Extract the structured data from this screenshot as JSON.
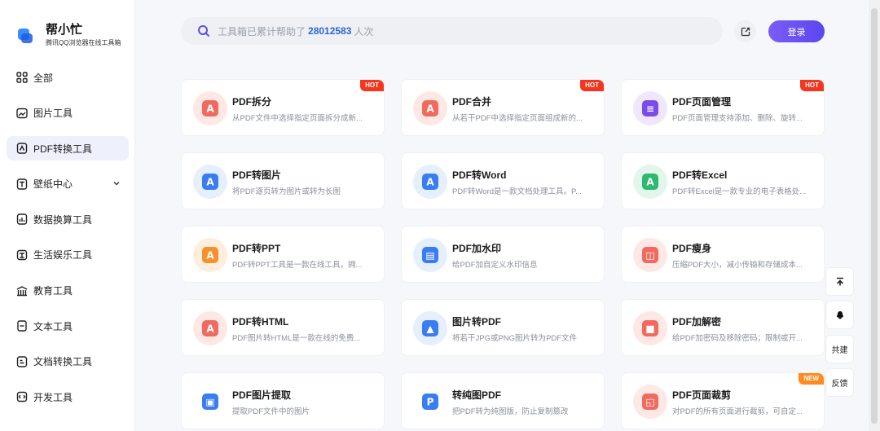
{
  "brand": {
    "name": "帮小忙",
    "tagline": "腾讯QQ浏览器在线工具箱"
  },
  "sidebar": {
    "items": [
      {
        "label": "全部",
        "icon": "grid-icon"
      },
      {
        "label": "图片工具",
        "icon": "image-icon"
      },
      {
        "label": "PDF转换工具",
        "icon": "pdf-icon",
        "active": true
      },
      {
        "label": "壁纸中心",
        "icon": "wallpaper-icon",
        "has_chevron": true
      },
      {
        "label": "数据换算工具",
        "icon": "data-icon"
      },
      {
        "label": "生活娱乐工具",
        "icon": "entertainment-icon"
      },
      {
        "label": "教育工具",
        "icon": "education-icon"
      },
      {
        "label": "文本工具",
        "icon": "text-icon"
      },
      {
        "label": "文档转换工具",
        "icon": "doc-convert-icon"
      },
      {
        "label": "开发工具",
        "icon": "dev-icon"
      }
    ]
  },
  "header": {
    "search_prefix": "工具箱已累计帮助了",
    "search_count": "28012583",
    "search_suffix": "人次",
    "login_label": "登录"
  },
  "tools": [
    {
      "title": "PDF拆分",
      "desc": "从PDF文件中选择指定页面拆分成新...",
      "badge": "HOT",
      "icon": "pdf-split-icon",
      "color": "#f06a5f",
      "bg": "#fde8e6"
    },
    {
      "title": "PDF合并",
      "desc": "从若干PDF中选择指定页面组成新的...",
      "badge": "HOT",
      "icon": "pdf-merge-icon",
      "color": "#f06a5f",
      "bg": "#fde8e6"
    },
    {
      "title": "PDF页面管理",
      "desc": "PDF页面管理支持添加、删除、旋转...",
      "badge": "HOT",
      "icon": "pdf-page-manage-icon",
      "color": "#7b4de8",
      "bg": "#efe8fc"
    },
    {
      "title": "PDF转图片",
      "desc": "将PDF逐页转为图片或转为长图",
      "badge": "",
      "icon": "pdf-to-image-icon",
      "color": "#3a7cf2",
      "bg": "#e6effd"
    },
    {
      "title": "PDF转Word",
      "desc": "PDF转Word是一款文档处理工具。P...",
      "badge": "",
      "icon": "pdf-to-word-icon",
      "color": "#3a7cf2",
      "bg": "#e6effd"
    },
    {
      "title": "PDF转Excel",
      "desc": "PDF转Excel是一款专业的电子表格处...",
      "badge": "",
      "icon": "pdf-to-excel-icon",
      "color": "#2eb872",
      "bg": "#e3f6ec"
    },
    {
      "title": "PDF转PPT",
      "desc": "PDF转PPT工具是一款在线工具，拥...",
      "badge": "",
      "icon": "pdf-to-ppt-icon",
      "color": "#f5922e",
      "bg": "#fdeede"
    },
    {
      "title": "PDF加水印",
      "desc": "给PDF加自定义水印信息",
      "badge": "",
      "icon": "pdf-watermark-icon",
      "color": "#3a7cf2",
      "bg": "#e6effd"
    },
    {
      "title": "PDF瘦身",
      "desc": "压缩PDF大小，减小传输和存储成本...",
      "badge": "",
      "icon": "pdf-compress-icon",
      "color": "#f06a5f",
      "bg": "#fde8e6"
    },
    {
      "title": "PDF转HTML",
      "desc": "PDF图片转HTML是一款在线的免费...",
      "badge": "",
      "icon": "pdf-to-html-icon",
      "color": "#f06a5f",
      "bg": "#fde8e6"
    },
    {
      "title": "图片转PDF",
      "desc": "将若干JPG或PNG图片转为PDF文件",
      "badge": "",
      "icon": "image-to-pdf-icon",
      "color": "#3a7cf2",
      "bg": "#e6effd"
    },
    {
      "title": "PDF加解密",
      "desc": "给PDF加密码及移除密码；限制或开...",
      "badge": "",
      "icon": "pdf-encrypt-icon",
      "color": "#f06a5f",
      "bg": "#fde8e6"
    },
    {
      "title": "PDF图片提取",
      "desc": "提取PDF文件中的图片",
      "badge": "",
      "icon": "pdf-image-extract-icon",
      "color": "#3a7cf2",
      "bg": "#ffffff"
    },
    {
      "title": "转纯图PDF",
      "desc": "把PDF转为纯图版，防止复制篡改",
      "badge": "",
      "icon": "pure-image-pdf-icon",
      "color": "#3a7cf2",
      "bg": "#ffffff"
    },
    {
      "title": "PDF页面裁剪",
      "desc": "对PDF的所有页面进行裁剪，可自定...",
      "badge": "NEW",
      "icon": "pdf-crop-icon",
      "color": "#f06a5f",
      "bg": "#fde8e6"
    }
  ],
  "float_buttons": [
    {
      "label": "",
      "icon": "back-to-top-icon"
    },
    {
      "label": "",
      "icon": "qq-icon"
    },
    {
      "label": "共建",
      "icon": ""
    },
    {
      "label": "反馈",
      "icon": ""
    }
  ]
}
